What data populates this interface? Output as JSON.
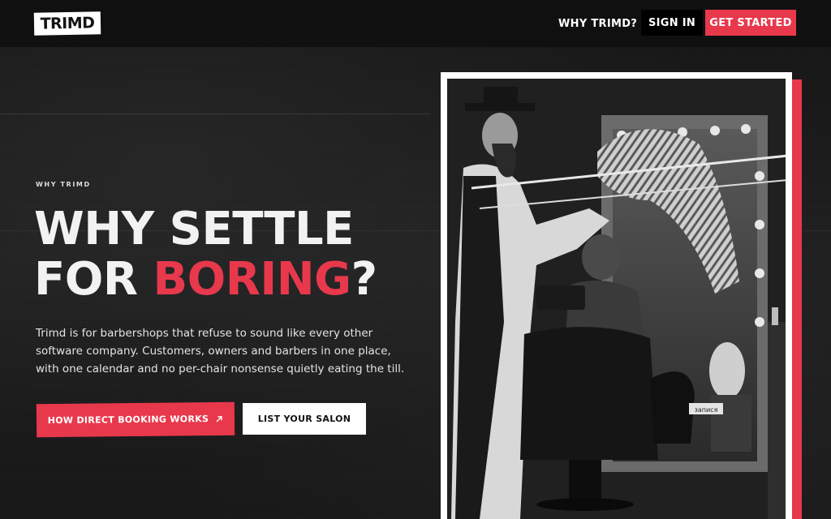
{
  "brand": {
    "logo_text": "TRIMD"
  },
  "nav": {
    "why_label": "WHY TRIMD?",
    "signin_label": "SIGN IN",
    "get_started_label": "GET STARTED"
  },
  "hero": {
    "eyebrow": "WHY TRIMD",
    "headline_line1": "WHY SETTLE",
    "headline_line2_prefix": "FOR ",
    "headline_accent": "BORING",
    "headline_suffix": "?",
    "body": "Trimd is for barbershops that refuse to sound like every other software company. Customers, owners and barbers in one place, with one calendar and no per-chair nonsense quietly eating the till.",
    "cta_primary_label": "HOW DIRECT BOOKING WORKS",
    "cta_primary_icon": "arrow-up-right-icon",
    "cta_secondary_label": "LIST YOUR SALON"
  },
  "photo": {
    "sign_text": "запися"
  },
  "colors": {
    "accent": "#e8384c",
    "background": "#1b1a1b",
    "topbar": "#111011",
    "text": "#ffffff"
  }
}
